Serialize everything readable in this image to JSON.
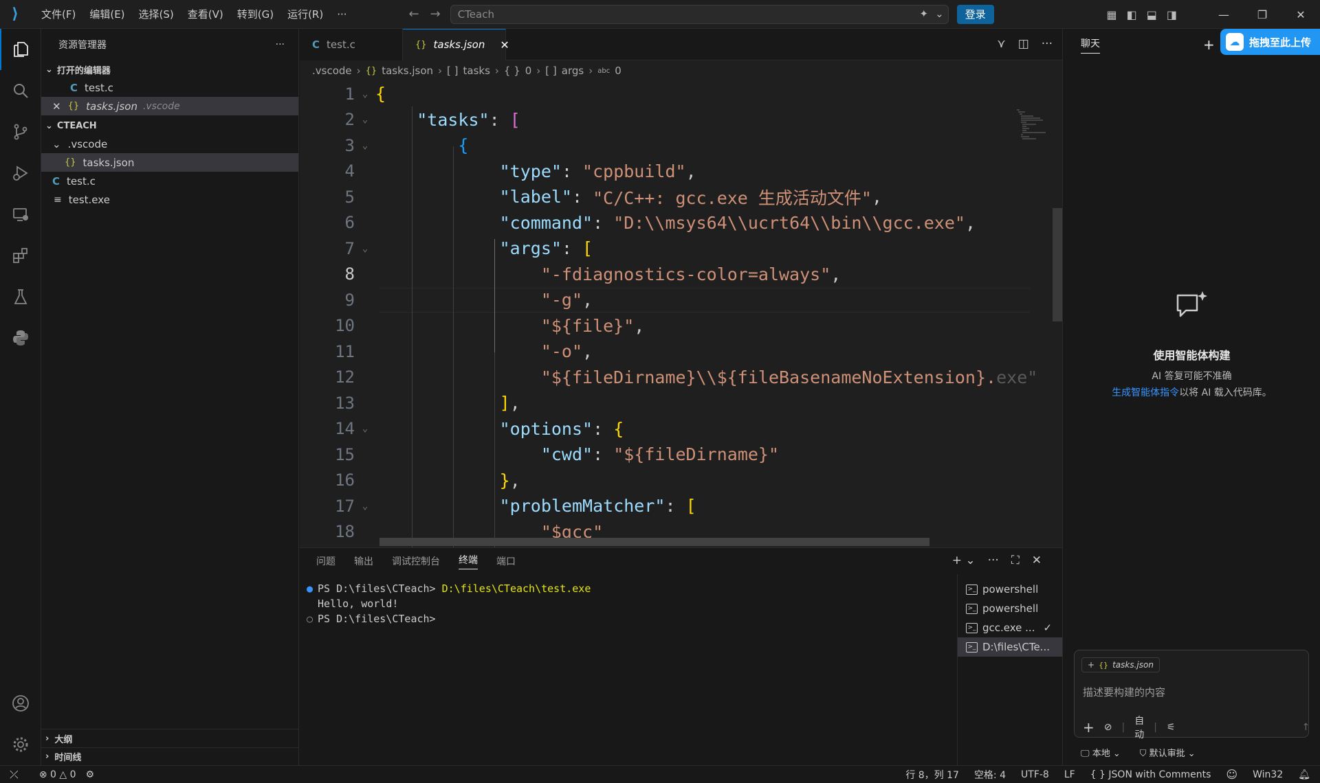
{
  "titlebar": {
    "menu": [
      "文件(F)",
      "编辑(E)",
      "选择(S)",
      "查看(V)",
      "转到(G)",
      "运行(R)",
      "···"
    ],
    "search_placeholder": "CTeach",
    "login_label": "登录"
  },
  "sidebar": {
    "title": "资源管理器",
    "open_editors_label": "打开的编辑器",
    "open_editors": [
      {
        "name": "test.c",
        "folder": ""
      },
      {
        "name": "tasks.json",
        "folder": ".vscode"
      }
    ],
    "project_label": "CTEACH",
    "tree": {
      "folder_vscode": ".vscode",
      "tasks_json": "tasks.json",
      "test_c": "test.c",
      "test_exe": "test.exe"
    },
    "outline_label": "大纲",
    "timeline_label": "时间线"
  },
  "tabs": [
    {
      "label": "test.c"
    },
    {
      "label": "tasks.json"
    }
  ],
  "breadcrumbs": [
    ".vscode",
    "tasks.json",
    "tasks",
    "0",
    "args",
    "0"
  ],
  "editor": {
    "current_line": 8,
    "line_numbers": [
      "1",
      "2",
      "3",
      "4",
      "5",
      "6",
      "7",
      "8",
      "9",
      "10",
      "11",
      "12",
      "13",
      "14",
      "15",
      "16",
      "17",
      "18"
    ],
    "lines": {
      "l2_key": "\"tasks\"",
      "l4_key": "\"type\"",
      "l4_val": "\"cppbuild\"",
      "l5_key": "\"label\"",
      "l5_val": "\"C/C++: gcc.exe 生成活动文件\"",
      "l6_key": "\"command\"",
      "l6_val": "\"D:\\\\msys64\\\\ucrt64\\\\bin\\\\gcc.exe\"",
      "l7_key": "\"args\"",
      "l8_val": "\"-fdiagnostics-color=always\"",
      "l9_val": "\"-g\"",
      "l10_val": "\"${file}\"",
      "l11_val": "\"-o\"",
      "l12_val": "\"${fileDirname}\\\\${fileBasenameNoExtension}.",
      "l12_ghost": "exe\"",
      "l14_key": "\"options\"",
      "l15_key": "\"cwd\"",
      "l15_val": "\"${fileDirname}\"",
      "l17_key": "\"problemMatcher\"",
      "l18_val": "\"$gcc\""
    }
  },
  "panel": {
    "tabs": [
      "问题",
      "输出",
      "调试控制台",
      "终端",
      "端口"
    ],
    "active_tab": "终端",
    "terminal": {
      "line1_prompt": "PS D:\\files\\CTeach> ",
      "line1_cmd": "D:\\files\\CTeach\\test.exe",
      "line2": "Hello, world!",
      "line3": "PS D:\\files\\CTeach>"
    },
    "terminals": [
      "powershell",
      "powershell",
      "gcc.exe ...",
      "D:\\files\\CTe..."
    ]
  },
  "chat": {
    "title": "聊天",
    "baidu_label": "拖拽至此上传",
    "empty_title": "使用智能体构建",
    "empty_line1": "AI 答复可能不准确",
    "empty_link": "生成智能体指令",
    "empty_line2_rest": "以将 AI 载入代码库。",
    "chip": "tasks.json",
    "input_placeholder": "描述要构建的内容",
    "mode": "自动",
    "footer_left": "本地",
    "footer_right": "默认审批"
  },
  "statusbar": {
    "errors": "0",
    "warnings": "0",
    "position": "行 8，列 17",
    "spaces": "空格: 4",
    "encoding": "UTF-8",
    "eol": "LF",
    "language": "JSON with Comments",
    "platform": "Win32"
  },
  "colors": {
    "accent": "#0078d4",
    "key": "#9cdcfe",
    "string": "#ce9178",
    "bracket_gold": "#ffd700",
    "bracket_purple": "#da70d6",
    "bracket_blue": "#179fff"
  }
}
